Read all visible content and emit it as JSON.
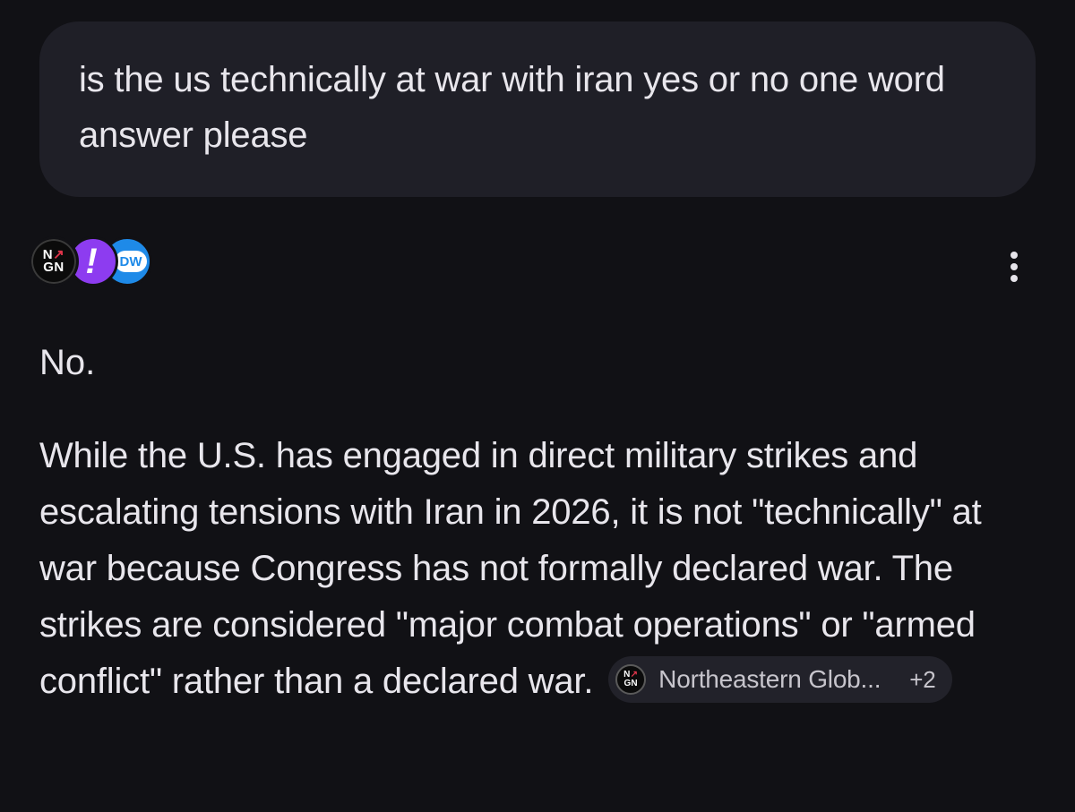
{
  "user_message": {
    "text": "is the us technically at war with iran yes or no one word answer please"
  },
  "sources": {
    "icons": [
      {
        "name": "ngn-source-icon",
        "line1": "N",
        "arrow": "↗",
        "line2": "GN"
      },
      {
        "name": "exclamation-source-icon",
        "glyph": "!"
      },
      {
        "name": "dw-source-icon",
        "glyph": "DW"
      }
    ]
  },
  "more_menu": {
    "icon": "more-vert-icon"
  },
  "response": {
    "short_answer": "No.",
    "body": "While the U.S. has engaged in direct military strikes and escalating tensions with Iran in 2026, it is not \"technically\" at war because Congress has not formally declared war. The strikes are considered \"major combat operations\" or \"armed conflict\" rather than a declared war.",
    "citation": {
      "label": "Northeastern Glob...",
      "count": "+2"
    }
  },
  "colors": {
    "background": "#111115",
    "bubble": "#1f1f27",
    "text": "#e8e6ec",
    "ngn_accent": "#e0344a",
    "purple_source": "#8d3cf0",
    "dw_blue": "#1e8ae8"
  }
}
